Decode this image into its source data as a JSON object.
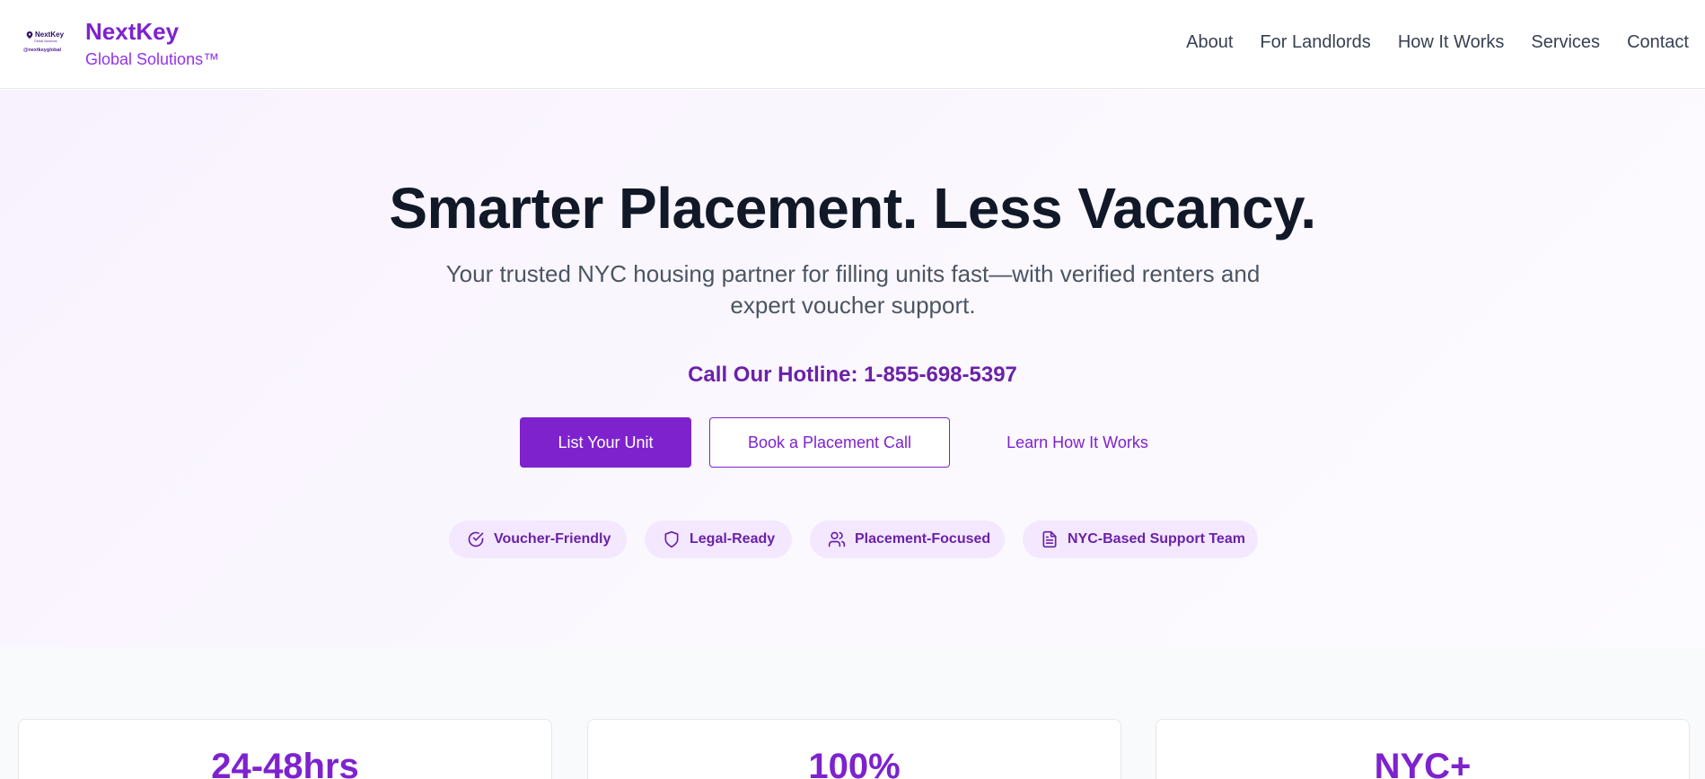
{
  "header": {
    "logo": {
      "name": "NextKey",
      "sub": "Global Solutions",
      "handle": "@nextkeyglobal"
    },
    "brand_name": "NextKey",
    "brand_sub": "Global Solutions™",
    "nav": [
      "About",
      "For Landlords",
      "How It Works",
      "Services",
      "Contact"
    ]
  },
  "hero": {
    "title": "Smarter Placement. Less Vacancy.",
    "subtitle": "Your trusted NYC housing partner for filling units fast—with verified renters and expert voucher support.",
    "hotline": "Call Our Hotline: 1-855-698-5397",
    "buttons": {
      "primary": "List Your Unit",
      "secondary": "Book a Placement Call",
      "link": "Learn How It Works"
    },
    "badges": [
      {
        "label": "Voucher-Friendly",
        "icon": "check-circle-icon"
      },
      {
        "label": "Legal-Ready",
        "icon": "shield-icon"
      },
      {
        "label": "Placement-Focused",
        "icon": "users-icon"
      },
      {
        "label": "NYC-Based Support Team",
        "icon": "document-icon"
      }
    ]
  },
  "stats": [
    "24-48hrs",
    "100%",
    "NYC+"
  ],
  "colors": {
    "accent": "#7e22ce",
    "accent_dark": "#6b21a8",
    "badge_bg": "#f3e8ff",
    "text": "#111827"
  }
}
